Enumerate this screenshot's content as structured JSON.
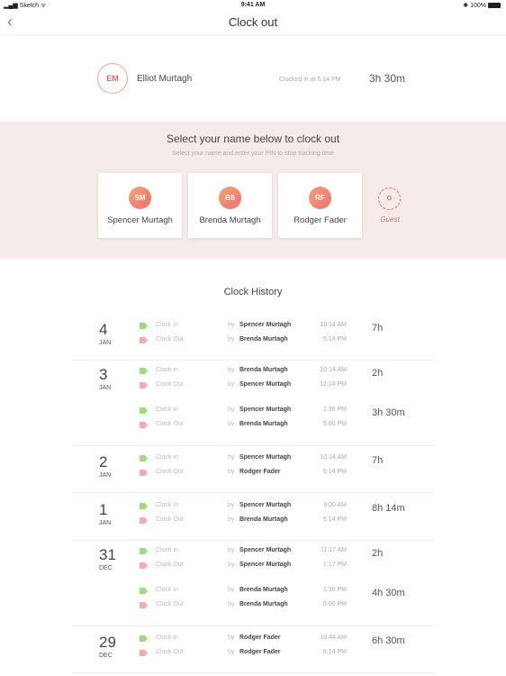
{
  "status_bar": {
    "carrier": "Sketch",
    "time": "9:41 AM",
    "battery": "100%"
  },
  "nav": {
    "back_icon": "chevron-left-icon",
    "title": "Clock out"
  },
  "current": {
    "initials": "EM",
    "name": "Elliot Murtagh",
    "status": "Clocked in at 5:14 PM",
    "duration": "3h 30m"
  },
  "select": {
    "title": "Select your name below to clock out",
    "subtitle": "Select your name and enter your PIN to stop tracking time",
    "people": [
      {
        "initials": "SM",
        "name": "Spencer Murtagh"
      },
      {
        "initials": "BS",
        "name": "Brenda Murtagh"
      },
      {
        "initials": "RF",
        "name": "Rodger Fader"
      }
    ],
    "guest": {
      "initials": "G",
      "label": "Guest"
    }
  },
  "history": {
    "title": "Clock History",
    "by": "by",
    "clock_in": "Clock in",
    "clock_out": "Clock Out",
    "days": [
      {
        "day": "4",
        "month": "JAN",
        "sessions": [
          {
            "in_by": "Spencer Murtagh",
            "in_time": "10:14 AM",
            "out_by": "Brenda Murtagh",
            "out_time": "5:14 PM",
            "duration": "7h"
          }
        ]
      },
      {
        "day": "3",
        "month": "JAN",
        "sessions": [
          {
            "in_by": "Brenda Murtagh",
            "in_time": "10:14 AM",
            "out_by": "Spencer Murtagh",
            "out_time": "12:14 PM",
            "duration": "2h"
          },
          {
            "in_by": "Spencer Murtagh",
            "in_time": "1:30 PM",
            "out_by": "Brenda Murtagh",
            "out_time": "5:00 PM",
            "duration": "3h 30m"
          }
        ]
      },
      {
        "day": "2",
        "month": "JAN",
        "sessions": [
          {
            "in_by": "Spencer Murtagh",
            "in_time": "10:14 AM",
            "out_by": "Rodger Fader",
            "out_time": "5:14 PM",
            "duration": "7h"
          }
        ]
      },
      {
        "day": "1",
        "month": "JAN",
        "sessions": [
          {
            "in_by": "Spencer Murtagh",
            "in_time": "9:00 AM",
            "out_by": "Brenda Murtagh",
            "out_time": "5:14 PM",
            "duration": "8h 14m"
          }
        ]
      },
      {
        "day": "31",
        "month": "DEC",
        "sessions": [
          {
            "in_by": "Spencer Murtagh",
            "in_time": "11:17 AM",
            "out_by": "Spencer Murtagh",
            "out_time": "1:17 PM",
            "duration": "2h"
          },
          {
            "in_by": "Brenda Murtagh",
            "in_time": "1:30 PM",
            "out_by": "Brenda Murtagh",
            "out_time": "6:00 PM",
            "duration": "4h 30m"
          }
        ]
      },
      {
        "day": "29",
        "month": "DEC",
        "sessions": [
          {
            "in_by": "Rodger Fader",
            "in_time": "10:44 AM",
            "out_by": "Rodger Fader",
            "out_time": "6:14 PM",
            "duration": "6h 30m"
          }
        ]
      }
    ]
  }
}
